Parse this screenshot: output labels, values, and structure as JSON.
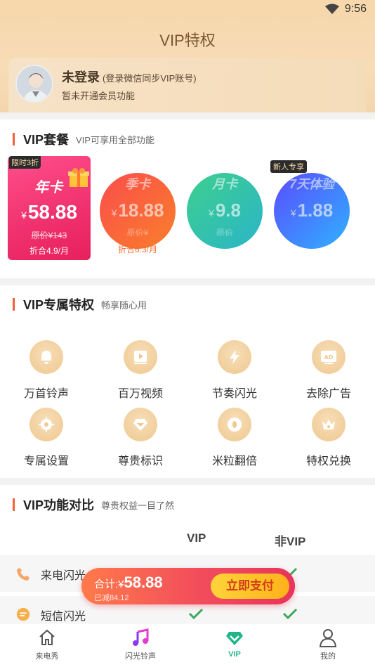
{
  "status": {
    "time": "9:56"
  },
  "header": {
    "title": "VIP特权"
  },
  "user": {
    "name": "未登录",
    "hint": "(登录微信同步VIP账号)",
    "status": "暂未开通会员功能"
  },
  "packages": {
    "title": "VIP套餐",
    "subtitle": "VIP可享用全部功能",
    "items": [
      {
        "badge": "限时3折",
        "name": "年卡",
        "currency": "¥",
        "price": "58.88",
        "original": "原价¥143",
        "per_month": "折合4.9/月",
        "selected": true
      },
      {
        "name": "季卡",
        "currency": "¥",
        "price": "18.88",
        "original": "原价¥",
        "per_month": "折合6.3/月"
      },
      {
        "name": "月卡",
        "currency": "¥",
        "price": "9.8",
        "original": "原价"
      },
      {
        "badge": "新人专享",
        "name": "7天体验",
        "currency": "¥",
        "price": "1.88"
      }
    ]
  },
  "privileges": {
    "title": "VIP专属特权",
    "subtitle": "畅享随心用",
    "items": [
      {
        "label": "万首铃声",
        "icon": "bell-icon"
      },
      {
        "label": "百万视频",
        "icon": "video-icon"
      },
      {
        "label": "节奏闪光",
        "icon": "flash-icon"
      },
      {
        "label": "去除广告",
        "icon": "ad-icon"
      },
      {
        "label": "专属设置",
        "icon": "gear-icon"
      },
      {
        "label": "尊贵标识",
        "icon": "diamond-icon"
      },
      {
        "label": "米粒翻倍",
        "icon": "coin-icon"
      },
      {
        "label": "特权兑换",
        "icon": "crown-icon"
      }
    ]
  },
  "compare": {
    "title": "VIP功能对比",
    "subtitle": "尊贵权益一目了然",
    "col_vip": "VIP",
    "col_nonvip": "非VIP",
    "rows": [
      {
        "label": "来电闪光",
        "icon": "phone-icon"
      },
      {
        "label": "短信闪光",
        "icon": "message-icon"
      }
    ]
  },
  "pay": {
    "total_label": "合计:",
    "currency": "¥",
    "total": "58.88",
    "saved": "已减84.12",
    "button": "立即支付"
  },
  "tabs": [
    {
      "label": "来电秀",
      "icon": "home-icon"
    },
    {
      "label": "闪光铃声",
      "icon": "music-note-icon"
    },
    {
      "label": "VIP",
      "icon": "vip-diamond-icon",
      "active": true
    },
    {
      "label": "我的",
      "icon": "user-icon"
    }
  ],
  "colors": {
    "accent": "#f25f3a",
    "tab_active": "#20b68a",
    "pay_button": "#ffc62a"
  }
}
